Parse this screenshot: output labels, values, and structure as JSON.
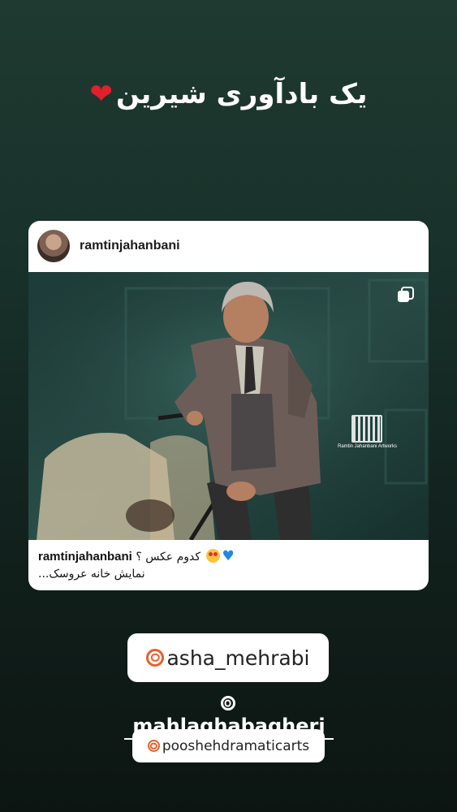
{
  "story": {
    "title": "یک بادآوری شیرین",
    "title_heart": "❤"
  },
  "post": {
    "username": "ramtinjahanbani",
    "watermark_text": "Ramtin Jahanbani Artworks",
    "caption": {
      "username": "ramtinjahanbani",
      "line1_text": "کدوم عکس ؟",
      "line2_text": "نمایش خانه عروسک..."
    }
  },
  "mentions": [
    {
      "handle": "asha_mehrabi"
    },
    {
      "handle": "mahlaghabagheri"
    },
    {
      "handle": "pooshehdramaticarts"
    }
  ],
  "colors": {
    "background_top": "#1f3a31",
    "background_bottom": "#0c1512",
    "heart": "#e0202c",
    "threads_icon": "#e8602c",
    "blue_heart": "#1e88e5"
  },
  "icons": [
    "red-heart-icon",
    "carousel-icon",
    "heart-eyes-emoji-icon",
    "blue-heart-icon",
    "threads-icon"
  ]
}
